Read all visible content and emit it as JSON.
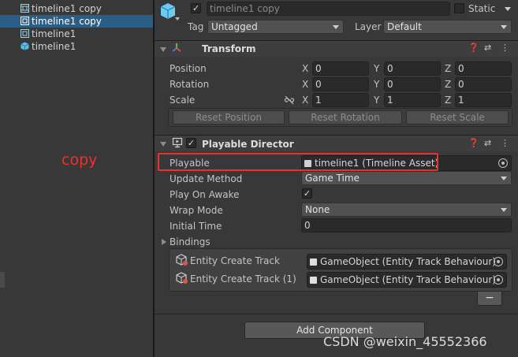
{
  "hierarchy": {
    "items": [
      {
        "label": "timeline1 copy",
        "icon": "gameobject-icon",
        "selected": false
      },
      {
        "label": "timeline1 copy",
        "icon": "gameobject-icon",
        "selected": true
      },
      {
        "label": "timeline1",
        "icon": "gameobject-icon",
        "selected": false
      },
      {
        "label": "timeline1",
        "icon": "prefab-cube-icon",
        "selected": false
      }
    ]
  },
  "annotation": {
    "copy_note": "copy"
  },
  "inspector": {
    "object_name": "timeline1 copy",
    "static_label": "Static",
    "tag_label": "Tag",
    "tag_value": "Untagged",
    "layer_label": "Layer",
    "layer_value": "Default",
    "transform": {
      "title": "Transform",
      "position_label": "Position",
      "rotation_label": "Rotation",
      "scale_label": "Scale",
      "x": "X",
      "y": "Y",
      "z": "Z",
      "position": [
        "0",
        "0",
        "0"
      ],
      "rotation": [
        "0",
        "0",
        "0"
      ],
      "scale": [
        "1",
        "1",
        "1"
      ],
      "reset_position": "Reset Position",
      "reset_rotation": "Reset Rotation",
      "reset_scale": "Reset Scale"
    },
    "director": {
      "title": "Playable Director",
      "playable_label": "Playable",
      "playable_value": "timeline1 (Timeline Asset)",
      "update_method_label": "Update Method",
      "update_method_value": "Game Time",
      "play_on_awake_label": "Play On Awake",
      "wrap_mode_label": "Wrap Mode",
      "wrap_mode_value": "None",
      "initial_time_label": "Initial Time",
      "initial_time_value": "0",
      "bindings_label": "Bindings",
      "bindings": [
        {
          "track": "Entity Create Track",
          "value": "GameObject (Entity Track Behaviour)"
        },
        {
          "track": "Entity Create Track (1)",
          "value": "GameObject (Entity Track Behaviour)"
        }
      ],
      "remove_label": "−"
    },
    "add_component": "Add Component"
  },
  "watermark": "CSDN @weixin_45552366",
  "colors": {
    "selection": "#2c5d87",
    "annotation_red": "#e8322f",
    "panel_bg": "#383838"
  }
}
